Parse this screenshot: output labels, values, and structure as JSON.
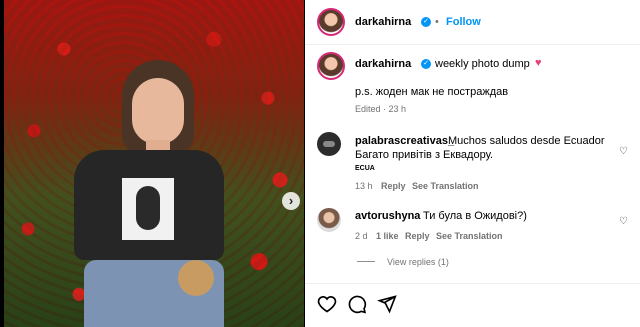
{
  "post": {
    "author": "darkahirna",
    "follow_label": "Follow",
    "separator": "•",
    "more_label": "···"
  },
  "caption": {
    "author": "darkahirna",
    "text": "weekly photo dump",
    "emoji": "♥",
    "line2": "p.s. жоден мак не постраждав",
    "edited": "Edited · 23 h"
  },
  "comments": [
    {
      "author": "palabrascreativas_",
      "text": "Muchos saludos desde Ecuador",
      "text2": "Багато привітів з Еквадору.",
      "tag": "ECUA",
      "time": "13 h",
      "reply_label": "Reply",
      "translate_label": "See Translation"
    },
    {
      "author": "avtorushyna",
      "text": "Ти була в Ожидові?)",
      "time": "2 d",
      "likes": "1 like",
      "reply_label": "Reply",
      "translate_label": "See Translation",
      "view_replies": "View replies (1)"
    }
  ],
  "carousel": {
    "next": "›"
  },
  "icons": [
    "heart-icon",
    "comment-icon",
    "share-icon",
    "verified-icon",
    "chevron-right-icon"
  ],
  "colors": {
    "accent": "#0095f6",
    "pink": "#e4407b"
  }
}
